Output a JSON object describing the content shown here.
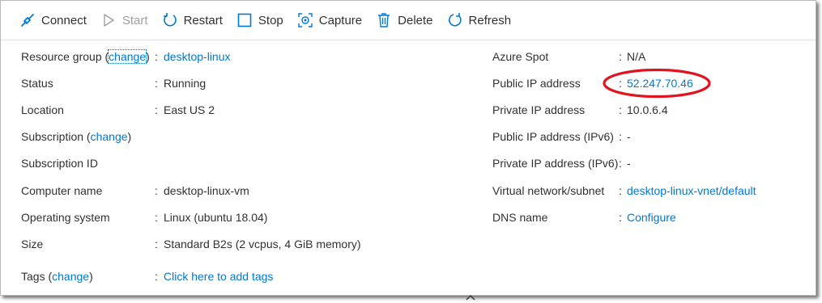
{
  "toolbar": {
    "connect": "Connect",
    "start": "Start",
    "restart": "Restart",
    "stop": "Stop",
    "capture": "Capture",
    "delete": "Delete",
    "refresh": "Refresh"
  },
  "left": {
    "resource_group_label": "Resource group (",
    "resource_group_change": "change",
    "resource_group_close": ")",
    "resource_group_value": "desktop-linux",
    "status_label": "Status",
    "status_value": "Running",
    "location_label": "Location",
    "location_value": "East US 2",
    "subscription_label": "Subscription (",
    "subscription_change": "change",
    "subscription_close": ")",
    "subscription_id_label": "Subscription ID",
    "computer_name_label": "Computer name",
    "computer_name_value": "desktop-linux-vm",
    "os_label": "Operating system",
    "os_value": "Linux (ubuntu 18.04)",
    "size_label": "Size",
    "size_value": "Standard B2s (2 vcpus, 4 GiB memory)",
    "tags_label": "Tags (",
    "tags_change": "change",
    "tags_close": ")",
    "tags_value": "Click here to add tags"
  },
  "right": {
    "spot_label": "Azure Spot",
    "spot_value": "N/A",
    "public_ip_label": "Public IP address",
    "public_ip_value": "52.247.70.46",
    "private_ip_label": "Private IP address",
    "private_ip_value": "10.0.6.4",
    "public_ipv6_label": "Public IP address (IPv6)",
    "public_ipv6_value": "-",
    "private_ipv6_label": "Private IP address (IPv6)",
    "private_ipv6_value": "-",
    "vnet_label": "Virtual network/subnet",
    "vnet_value": "desktop-linux-vnet/default",
    "dns_label": "DNS name",
    "dns_value": "Configure"
  },
  "separator": ":",
  "colors": {
    "accent": "#0078d4",
    "annotation": "#e0141e"
  },
  "icons": [
    "connect-icon",
    "start-icon",
    "restart-icon",
    "stop-icon",
    "capture-icon",
    "delete-icon",
    "refresh-icon",
    "chevron-up-icon"
  ]
}
